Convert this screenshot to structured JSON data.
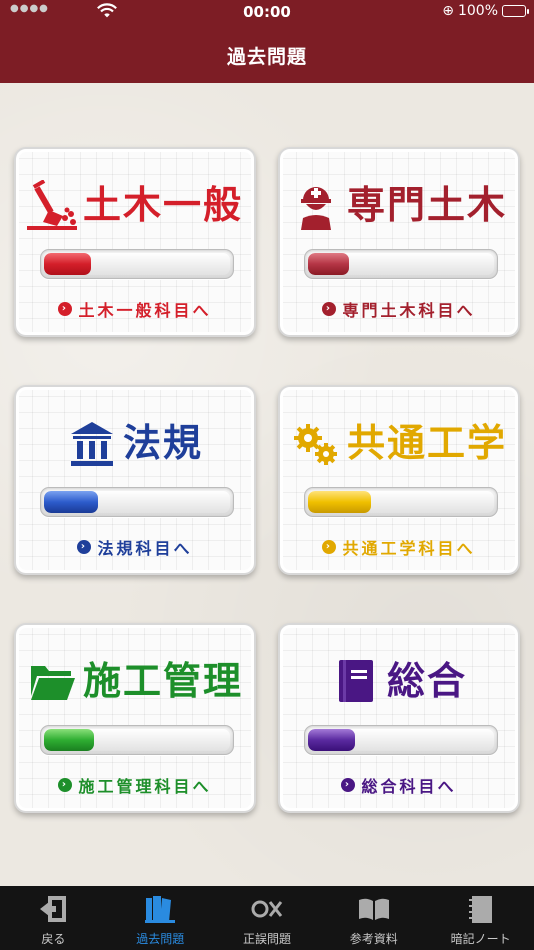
{
  "status": {
    "time": "00:00",
    "battery": "100%"
  },
  "nav": {
    "title": "過去問題"
  },
  "cards": [
    {
      "title": "土木一般",
      "link": "土木一般科目へ",
      "color": "#d41f2a",
      "progress": 0.25,
      "icon": "excavation-shovel-icon"
    },
    {
      "title": "専門土木",
      "link": "専門土木科目へ",
      "color": "#a3202d",
      "progress": 0.22,
      "icon": "hardhat-worker-icon"
    },
    {
      "title": "法規",
      "link": "法規科目へ",
      "color": "#1f3f9a",
      "progress": 0.29,
      "icon": "government-building-icon"
    },
    {
      "title": "共通工学",
      "link": "共通工学科目へ",
      "color": "#e1a800",
      "progress": 0.34,
      "icon": "gears-icon"
    },
    {
      "title": "施工管理",
      "link": "施工管理科目へ",
      "color": "#1d8f2a",
      "progress": 0.27,
      "icon": "folder-icon"
    },
    {
      "title": "総合",
      "link": "総合科目へ",
      "color": "#4a1784",
      "progress": 0.25,
      "icon": "book-icon"
    }
  ],
  "tabs": [
    {
      "label": "戻る",
      "icon": "back-icon",
      "active": false
    },
    {
      "label": "過去問題",
      "icon": "books-icon",
      "active": true
    },
    {
      "label": "正誤問題",
      "icon": "ox-icon",
      "active": false
    },
    {
      "label": "参考資料",
      "icon": "open-book-icon",
      "active": false
    },
    {
      "label": "暗記ノート",
      "icon": "notebook-icon",
      "active": false
    }
  ]
}
